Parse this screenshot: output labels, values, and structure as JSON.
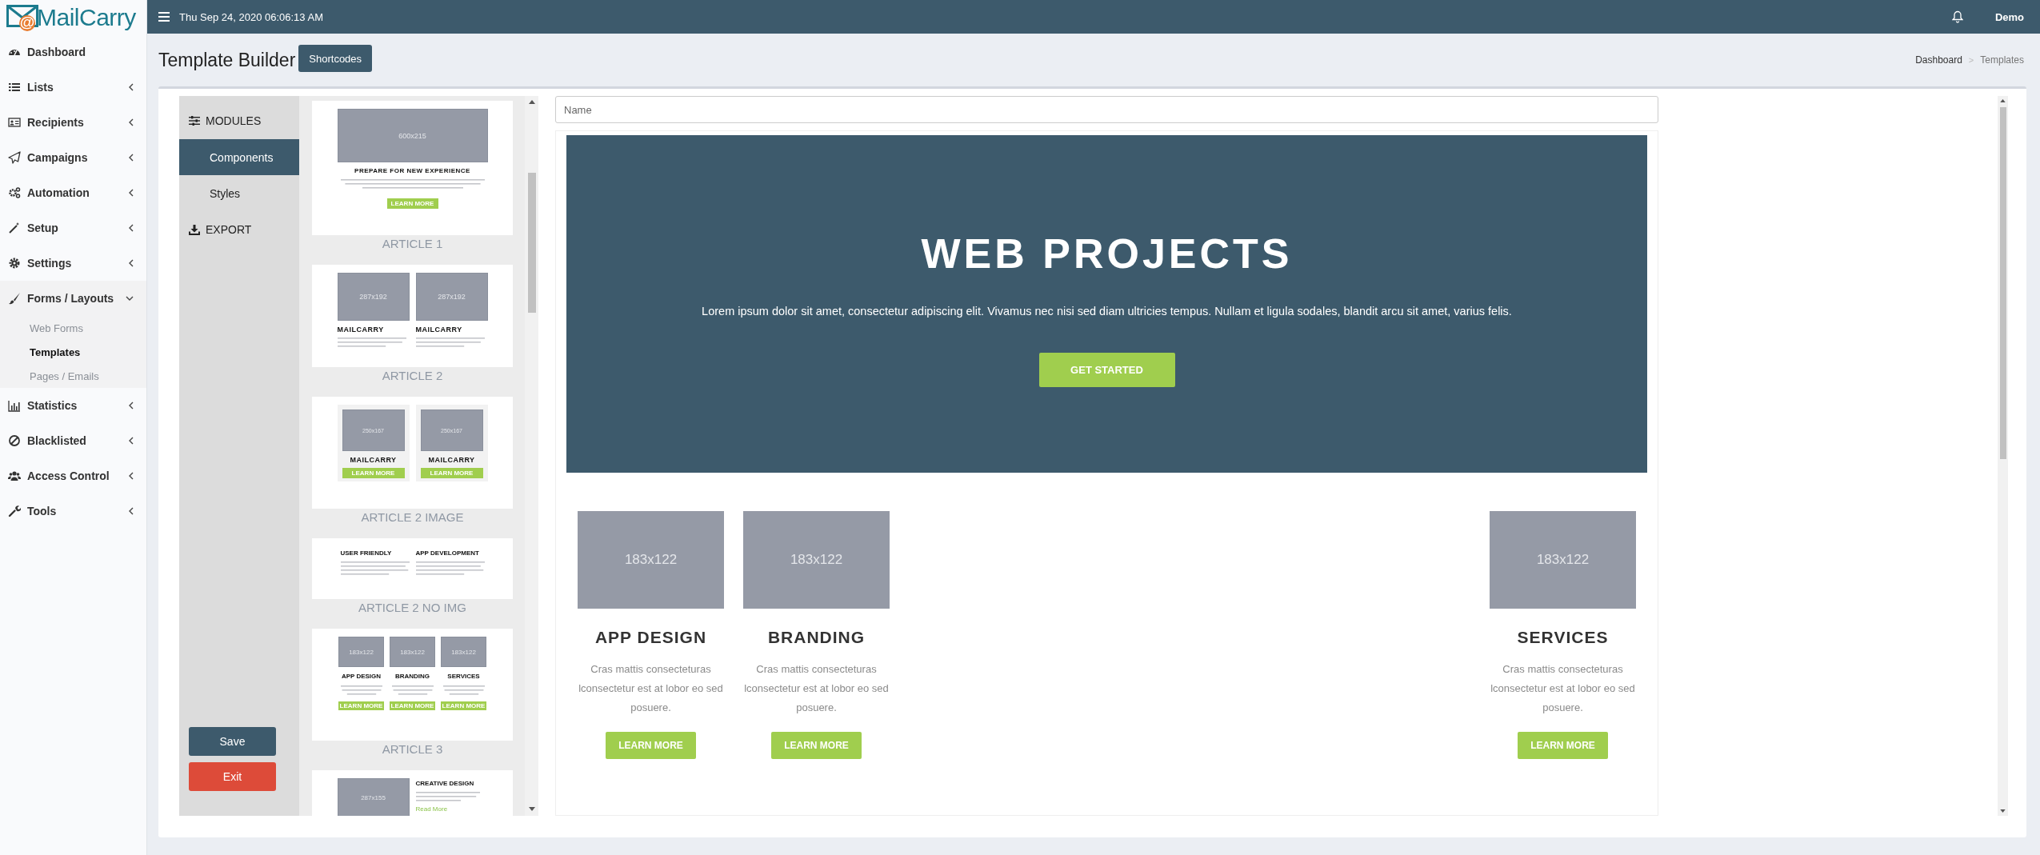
{
  "logo": {
    "mark": "@",
    "name": "MailCarry"
  },
  "sidebar": {
    "items": [
      {
        "label": "Dashboard",
        "kind": "link"
      },
      {
        "label": "Lists",
        "kind": "group",
        "expanded": false
      },
      {
        "label": "Recipients",
        "kind": "group",
        "expanded": false
      },
      {
        "label": "Campaigns",
        "kind": "group",
        "expanded": false
      },
      {
        "label": "Automation",
        "kind": "group",
        "expanded": false
      },
      {
        "label": "Setup",
        "kind": "group",
        "expanded": false
      },
      {
        "label": "Settings",
        "kind": "group",
        "expanded": false
      },
      {
        "label": "Forms / Layouts",
        "kind": "group",
        "expanded": true,
        "children": [
          {
            "label": "Web Forms",
            "selected": false
          },
          {
            "label": "Templates",
            "selected": true
          },
          {
            "label": "Pages / Emails",
            "selected": false
          }
        ]
      },
      {
        "label": "Statistics",
        "kind": "group",
        "expanded": false
      },
      {
        "label": "Blacklisted",
        "kind": "group",
        "expanded": false
      },
      {
        "label": "Access Control",
        "kind": "group",
        "expanded": false
      },
      {
        "label": "Tools",
        "kind": "group",
        "expanded": false
      }
    ]
  },
  "topbar": {
    "datetime": "Thu Sep 24, 2020 06:06:13 AM",
    "user": "Demo"
  },
  "header": {
    "title": "Template Builder",
    "button": "Shortcodes",
    "breadcrumb": [
      "Dashboard",
      "Templates"
    ],
    "separator": ">"
  },
  "builder": {
    "modules": [
      {
        "kind": "section",
        "label": "MODULES",
        "selected": false
      },
      {
        "kind": "tab",
        "label": "Components",
        "selected": true
      },
      {
        "kind": "tab",
        "label": "Styles",
        "selected": false
      },
      {
        "kind": "section",
        "label": "EXPORT",
        "selected": false
      }
    ],
    "save": "Save",
    "exit": "Exit",
    "thumbnails": [
      {
        "kind": "hero",
        "label": "ARTICLE 1",
        "columns": [
          {
            "image": "600x215",
            "title": "PREPARE FOR NEW EXPERIENCE",
            "button": "LEARN MORE"
          }
        ]
      },
      {
        "kind": "two_col",
        "label": "ARTICLE 2",
        "columns": [
          {
            "image": "287x192",
            "title": "MAILCARRY"
          },
          {
            "image": "287x192",
            "title": "MAILCARRY"
          }
        ]
      },
      {
        "kind": "two_col_image",
        "label": "ARTICLE 2 IMAGE",
        "columns": [
          {
            "image": "250x167",
            "title": "MAILCARRY",
            "button": "LEARN MORE"
          },
          {
            "image": "250x167",
            "title": "MAILCARRY",
            "button": "LEARN MORE"
          }
        ]
      },
      {
        "kind": "two_col_text",
        "label": "ARTICLE 2 NO IMG",
        "columns": [
          {
            "title": "USER FRIENDLY"
          },
          {
            "title": "APP DEVELOPMENT"
          }
        ]
      },
      {
        "kind": "three_col",
        "label": "ARTICLE 3",
        "columns": [
          {
            "image": "183x122",
            "title": "APP DESIGN",
            "button": "LEARN MORE"
          },
          {
            "image": "183x122",
            "title": "BRANDING",
            "button": "LEARN MORE"
          },
          {
            "image": "183x122",
            "title": "SERVICES",
            "button": "LEARN MORE"
          }
        ]
      },
      {
        "kind": "image_text",
        "columns": [
          {
            "image": "287x155",
            "title": "CREATIVE DESIGN",
            "link": "Read More"
          }
        ]
      }
    ],
    "name_field": {
      "placeholder": "Name"
    },
    "canvas": {
      "hero": {
        "title": "WEB PROJECTS",
        "text": "Lorem ipsum dolor sit amet, consectetur adipiscing elit. Vivamus nec nisi sed diam ultricies tempus. Nullam et ligula sodales, blandit arcu sit amet, varius felis.",
        "button": "GET STARTED"
      },
      "cards": [
        {
          "image": "183x122",
          "title": "APP DESIGN",
          "text": "Cras mattis consecteturas lconsectetur est at lobor eo sed posuere.",
          "button": "LEARN MORE"
        },
        {
          "image": "183x122",
          "title": "BRANDING",
          "text": "Cras mattis consecteturas lconsectetur est at lobor eo sed posuere.",
          "button": "LEARN MORE"
        },
        {
          "image": "183x122",
          "title": "SERVICES",
          "text": "Cras mattis consecteturas lconsectetur est at lobor eo sed posuere.",
          "button": "LEARN MORE"
        }
      ]
    }
  }
}
